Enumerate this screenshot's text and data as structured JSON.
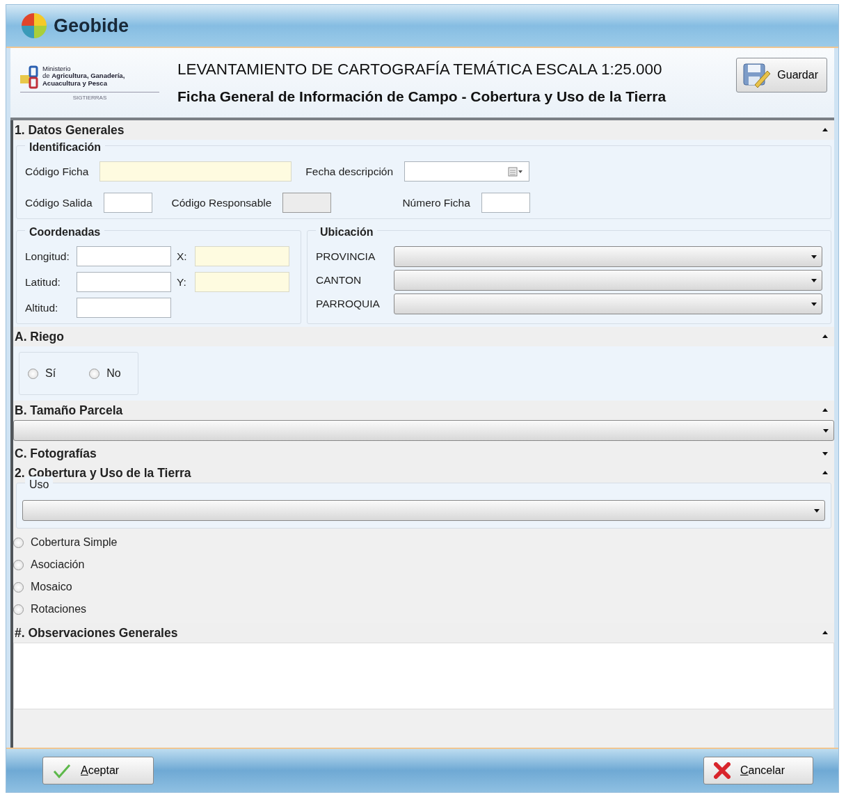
{
  "window": {
    "title": "Geobide"
  },
  "header": {
    "logo_lines": [
      "Ministerio",
      "de **Agricultura, Ganadería,**",
      "**Acuacultura y Pesca**"
    ],
    "logo_caption": "SIGTIERRAS",
    "title": "LEVANTAMIENTO DE CARTOGRAFÍA TEMÁTICA ESCALA 1:25.000",
    "subtitle": "Ficha General de Información de Campo - Cobertura y Uso de la Tierra",
    "save_button": "Guardar"
  },
  "sections": [
    {
      "kind": "general",
      "title": "1. Datos Generales",
      "expanded": true,
      "identificacion": {
        "title": "Identificación",
        "rows": [
          [
            {
              "label": "Código Ficha",
              "kind": "long",
              "required": true,
              "disabled": false
            },
            {
              "label": "Fecha descripción",
              "kind": "date",
              "required": false,
              "disabled": false
            }
          ],
          [
            {
              "label": "Código Salida",
              "kind": "short",
              "required": false,
              "disabled": false
            },
            {
              "label": "Código Responsable",
              "kind": "short",
              "required": false,
              "disabled": true
            },
            {
              "label": "Número Ficha",
              "kind": "short",
              "required": false,
              "disabled": false
            }
          ]
        ]
      },
      "coordenadas": {
        "title": "Coordenadas",
        "rows": [
          [
            {
              "label": "Longitud:",
              "required": false
            },
            {
              "label": "X:",
              "required": true
            }
          ],
          [
            {
              "label": "Latitud:",
              "required": false
            },
            {
              "label": "Y:",
              "required": true
            }
          ],
          [
            {
              "label": "Altitud:",
              "required": false
            }
          ]
        ]
      },
      "ubicacion": {
        "title": "Ubicación",
        "selects": [
          "PROVINCIA",
          "CANTON",
          "PARROQUIA"
        ]
      }
    },
    {
      "kind": "radio",
      "title": "A. Riego",
      "expanded": true,
      "options": [
        {
          "label": "Sí",
          "selected": false
        },
        {
          "label": "No",
          "selected": false
        }
      ]
    },
    {
      "kind": "dropdown",
      "title": "B. Tamaño Parcela",
      "expanded": true
    },
    {
      "title": "C. Fotografías",
      "expanded": false
    },
    {
      "kind": "cobertura",
      "title": "2. Cobertura y Uso de la Tierra",
      "expanded": true,
      "group_title": "Uso",
      "options": [
        {
          "label": "Cobertura Simple",
          "selected": false
        },
        {
          "label": "Asociación",
          "selected": false
        },
        {
          "label": "Mosaico",
          "selected": false
        },
        {
          "label": "Rotaciones",
          "selected": false
        }
      ]
    },
    {
      "kind": "notes",
      "title": "#. Observaciones Generales",
      "expanded": true
    }
  ],
  "footer": [
    {
      "kind": "accept",
      "label": "Aceptar"
    },
    {
      "kind": "cancel",
      "label": "Cancelar"
    }
  ]
}
